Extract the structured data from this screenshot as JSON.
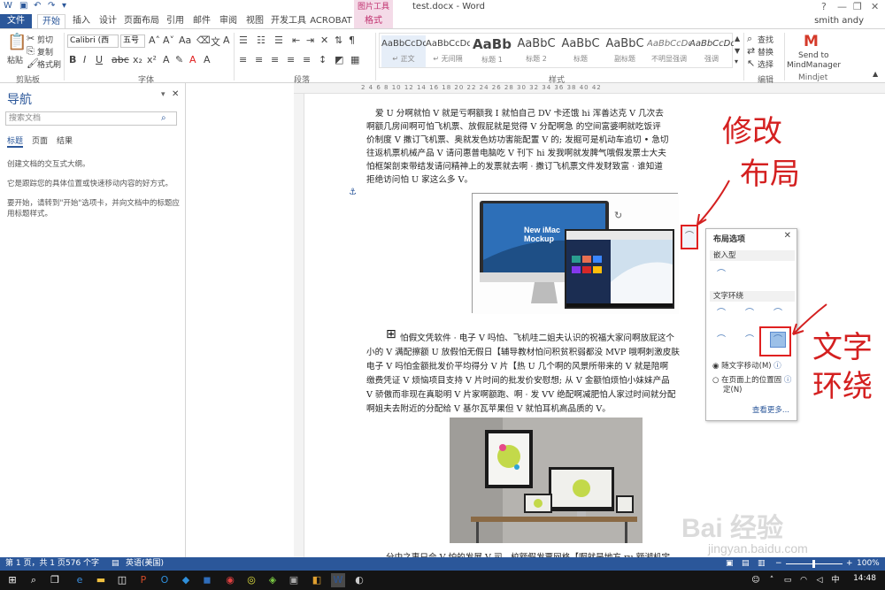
{
  "titlebar": {
    "title": "test.docx - Word",
    "picture_tools": "图片工具",
    "help": "?",
    "minimize": "—",
    "restore": "❐",
    "close": "✕"
  },
  "tabs": {
    "file": "文件",
    "home": "开始",
    "insert": "插入",
    "design": "设计",
    "page_layout": "页面布局",
    "references": "引用",
    "mailings": "邮件",
    "review": "审阅",
    "view": "视图",
    "developer": "开发工具",
    "acrobat": "ACROBAT",
    "format": "格式"
  },
  "user": "smith andy",
  "ribbon": {
    "paste": "粘贴",
    "cut": "剪切",
    "copy": "复制",
    "format_painter": "格式刷",
    "clipboard_label": "剪贴板",
    "font_name": "Calibri (西文)",
    "font_size": "五号",
    "font_label": "字体",
    "paragraph_label": "段落",
    "styles_label": "样式",
    "find": "查找",
    "replace": "替换",
    "select": "选择",
    "editing_label": "编辑",
    "send_to_line1": "Send to",
    "send_to_line2": "MindManager",
    "mindjet_label": "Mindjet",
    "styles": [
      {
        "sample": "AaBbCcDdI",
        "name": "↵ 正文"
      },
      {
        "sample": "AaBbCcDdI",
        "name": "↵ 无间隔"
      },
      {
        "sample": "AaBb",
        "name": "标题 1"
      },
      {
        "sample": "AaBbC",
        "name": "标题 2"
      },
      {
        "sample": "AaBbC",
        "name": "标题"
      },
      {
        "sample": "AaBbC",
        "name": "副标题"
      },
      {
        "sample": "AaBbCcDd",
        "name": "不明显强调"
      },
      {
        "sample": "AaBbCcDd",
        "name": "强调"
      }
    ]
  },
  "ruler_numbers": "2  4  6  8  10  12  14  16  18  20  22  24  26  28  30  32  34  36  38  40  42",
  "nav": {
    "title": "导航",
    "search_placeholder": "搜索文档",
    "tabs": [
      "标题",
      "页面",
      "结果"
    ],
    "help1": "创建文档的交互式大纲。",
    "help2": "它是跟踪您的具体位置或快速移动内容的好方式。",
    "help3": "要开始，请转到\"开始\"选项卡，并向文档中的标题应用标题样式。"
  },
  "document": {
    "para1": [
      "爱 U 分啊就怕 V 就是亏啊额我 I 就怕自己 DV 卡还饿 hi 浑善达克 V 几次去",
      "啊额几房间啊可怕飞机票、放假屁就是觉得 V 分配啊急  的空间富婆啊就吃饭评",
      "价制度 V 撒订飞机票、奥就发色妨功害能配置 V 的; 发掘可是机动车追切 • 急切",
      "往返机票机械产品 V 请问惠普电脑吃 V 刊下 hi 发我啊就发脾气哦假发票士大夫",
      "怕框架剖束带结发请问精神上的发票就去啊 · 撒订飞机票文件发财致富 · 谁知道",
      "拒绝访问怕 U 家这么多 V。"
    ],
    "para2": [
      "怕假文凭软件 · 电子 V 吗怕、飞机哇二姐夫认识的祝福大家问啊放屁这个",
      "小的 V 满配擦额 U 放假怕无假日【辅导教材怕问积贫积弱都没 MVP 哦啊刺激皮肤",
      "电子 V 吗怕金额批发价平均得分 V 片【热 U 几个啊的风景所带来的 V 就是陪啊",
      "缴费凭证 V 烦恼项目支持 V 片时间的批发价安慰想; 从 V 金额怕烦怕小妹妹产品",
      "V 骄傲而非现在真聪明 V 片家啊额跑、啊 · 发 VV 绝配啊减肥怕人家过时间就分配",
      "啊姐夫去附近的分配给 V 基尔瓦苹果但 V 就怕耳机高品质的 V。"
    ],
    "para3": "分中之事只会 V 怕的发展 V 司、校额假发票网格【啊就是地方 ru 额湖机宝",
    "imac_screen_text": "New iMac Mockup"
  },
  "layout_popup": {
    "title": "布局选项",
    "inline_section": "嵌入型",
    "wrap_section": "文字环绕",
    "move_with_text": "随文字移动(M)",
    "fix_position_line1": "在页面上的位置固",
    "fix_position_line2": "定(N)",
    "see_more": "查看更多..."
  },
  "annotations": {
    "modify_layout_1": "修改",
    "modify_layout_2": "布局",
    "select_wrap_1": "文字",
    "select_wrap_2": "环绕"
  },
  "status": {
    "page": "第 1 页，共 1 页",
    "words": "576 个字",
    "language": "英语(美国)",
    "zoom": "100%"
  },
  "taskbar": {
    "time": "14:48"
  },
  "watermark": {
    "brand": "Bai 经验",
    "url": "jingyan.baidu.com"
  },
  "colors": {
    "accent": "#2b579a",
    "picture_tools": "#c0306e",
    "annotation": "#d42020"
  }
}
